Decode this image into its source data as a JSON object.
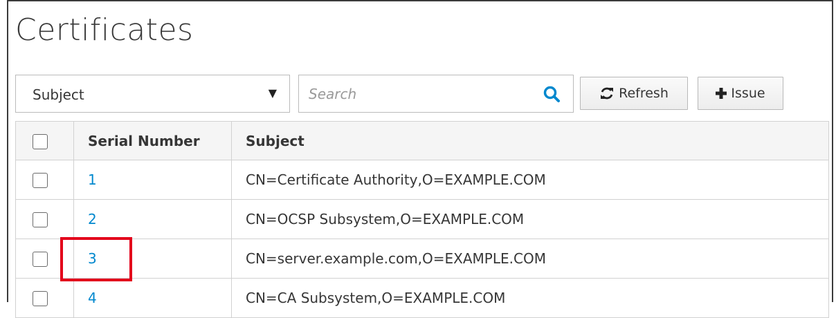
{
  "page": {
    "title": "Certificates"
  },
  "toolbar": {
    "filter_select": {
      "selected": "Subject"
    },
    "search": {
      "placeholder": "Search"
    },
    "refresh_label": "Refresh",
    "issue_label": "Issue"
  },
  "table": {
    "columns": [
      "Serial Number",
      "Subject"
    ],
    "rows": [
      {
        "serial": "1",
        "subject": "CN=Certificate Authority,O=EXAMPLE.COM"
      },
      {
        "serial": "2",
        "subject": "CN=OCSP Subsystem,O=EXAMPLE.COM"
      },
      {
        "serial": "3",
        "subject": "CN=server.example.com,O=EXAMPLE.COM"
      },
      {
        "serial": "4",
        "subject": "CN=CA Subsystem,O=EXAMPLE.COM"
      }
    ]
  },
  "colors": {
    "link": "#0088ce",
    "highlight": "#e3001b"
  }
}
